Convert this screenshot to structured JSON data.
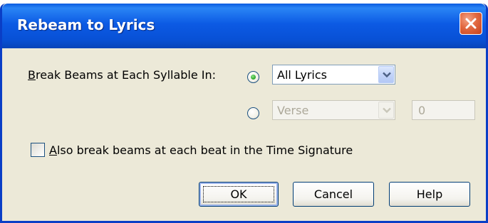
{
  "dialog": {
    "title": "Rebeam to Lyrics",
    "close_icon": "close-icon"
  },
  "break_section": {
    "label_accel": "B",
    "label_rest": "reak Beams at Each Syllable In:",
    "radio_all_lyrics_selected": true,
    "radio_verse_selected": false,
    "lyrics_select_value": "All Lyrics",
    "verse_select_value": "Verse",
    "verse_number_value": "0"
  },
  "beat_option": {
    "checked": false,
    "label_accel": "A",
    "label_rest": "lso break beams at each beat in the Time Signature"
  },
  "buttons": {
    "ok": "OK",
    "cancel": "Cancel",
    "help": "Help"
  },
  "colors": {
    "titlebar": "#0851d6",
    "dialog_bg": "#ece9d8",
    "close_button": "#e2683f",
    "radio_dot": "#27a424"
  }
}
